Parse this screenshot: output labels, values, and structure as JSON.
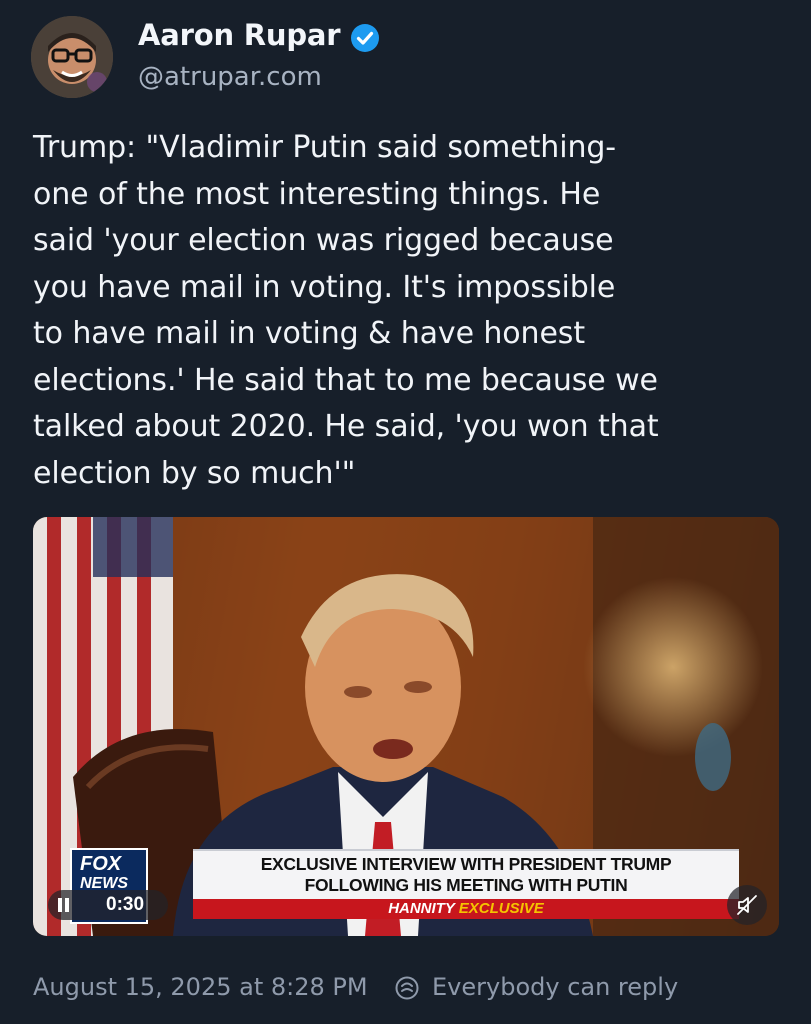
{
  "author": {
    "display_name": "Aaron Rupar",
    "handle": "@atrupar.com",
    "verified": true
  },
  "post": {
    "text": "Trump: \"Vladimir Putin said something-\none of the most interesting things. He\nsaid 'your election was rigged because\nyou have mail in voting. It's impossible\nto have mail in voting & have honest\nelections.' He said that to me because we\ntalked about 2020. He said, 'you won that\nelection by so much'\""
  },
  "video": {
    "chyron_line1": "EXCLUSIVE INTERVIEW WITH PRESIDENT TRUMP",
    "chyron_line2": "FOLLOWING HIS MEETING WITH PUTIN",
    "tag_prefix": "HANNITY",
    "tag_suffix": "EXCLUSIVE",
    "network_logo_line1": "FOX",
    "network_logo_line2": "NEWS",
    "time": "0:30",
    "playing": true,
    "muted": true
  },
  "footer": {
    "timestamp": "August 15, 2025 at 8:28 PM",
    "reply_setting": "Everybody can reply"
  },
  "colors": {
    "background": "#171f2a",
    "verified_badge": "#1d9bf0",
    "muted_text": "#8f9aab",
    "chyron_red": "#c7161d"
  }
}
